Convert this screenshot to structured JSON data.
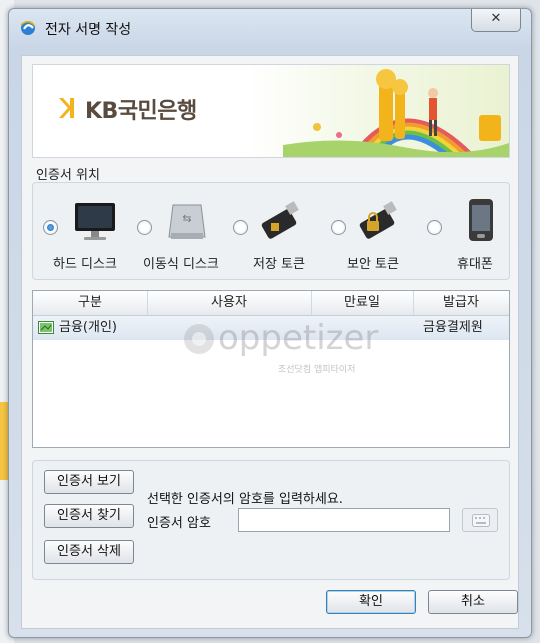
{
  "window": {
    "title": "전자 서명 작성",
    "close_label": "✕"
  },
  "banner": {
    "bank_name": "KB국민은행"
  },
  "location": {
    "section_label": "인증서 위치",
    "items": [
      {
        "label": "하드 디스크",
        "icon": "monitor-icon",
        "checked": true
      },
      {
        "label": "이동식 디스크",
        "icon": "removable-disk-icon",
        "checked": false
      },
      {
        "label": "저장 토큰",
        "icon": "usb-token-icon",
        "checked": false
      },
      {
        "label": "보안 토큰",
        "icon": "security-token-icon",
        "checked": false
      },
      {
        "label": "휴대폰",
        "icon": "mobile-phone-icon",
        "checked": false
      }
    ]
  },
  "cert_table": {
    "headers": [
      "구분",
      "사용자",
      "만료일",
      "발급자"
    ],
    "rows": [
      {
        "type": "금융(개인)",
        "user": "",
        "expires": "",
        "issuer": "금융결제원"
      }
    ]
  },
  "watermark": {
    "text": "oppetizer",
    "sub": "조선닷컴 앱피타이저"
  },
  "actions": {
    "view_label": "인증서 보기",
    "find_label": "인증서 찾기",
    "delete_label": "인증서 삭제",
    "prompt": "선택한 인증서의 암호를 입력하세요.",
    "password_label": "인증서 암호",
    "password_value": ""
  },
  "footer": {
    "ok_label": "확인",
    "cancel_label": "취소"
  },
  "colors": {
    "accent": "#1c5fa8",
    "kb_yellow": "#f2b31b",
    "kb_text": "#5a4b3f"
  }
}
